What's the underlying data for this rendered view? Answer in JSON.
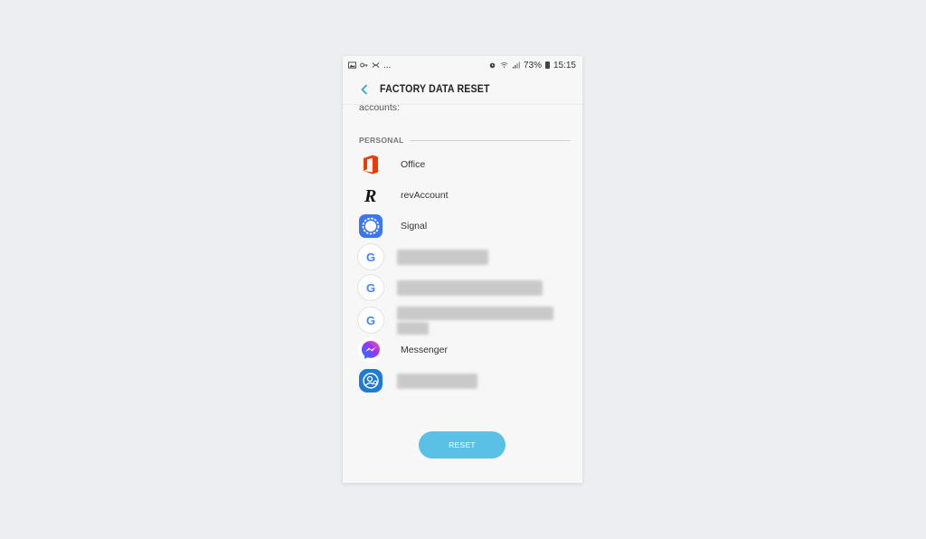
{
  "status_bar": {
    "left_icons": [
      "gallery-icon",
      "vpn-key-icon",
      "cast-icon"
    ],
    "ellipsis": "...",
    "battery": "73%",
    "time": "15:15"
  },
  "header": {
    "title": "FACTORY DATA RESET"
  },
  "intro_text_fragment": "accounts:",
  "section": {
    "label": "PERSONAL"
  },
  "accounts": [
    {
      "icon": "office-icon",
      "label": "Office"
    },
    {
      "icon": "revolut-icon",
      "label": "revAccount"
    },
    {
      "icon": "signal-icon",
      "label": "Signal"
    },
    {
      "icon": "google-icon",
      "label": "",
      "redacted": true
    },
    {
      "icon": "google-icon",
      "label": "",
      "redacted": true
    },
    {
      "icon": "google-icon",
      "label": "",
      "redacted": true
    },
    {
      "icon": "messenger-icon",
      "label": "Messenger"
    },
    {
      "icon": "samsung-account-icon",
      "label": "",
      "redacted": true
    }
  ],
  "reset_button": {
    "label": "RESET"
  },
  "colors": {
    "accent": "#5bc0e6",
    "back_arrow": "#2f9fd0",
    "office": "#eb3c00",
    "signal": "#3a76f0"
  }
}
